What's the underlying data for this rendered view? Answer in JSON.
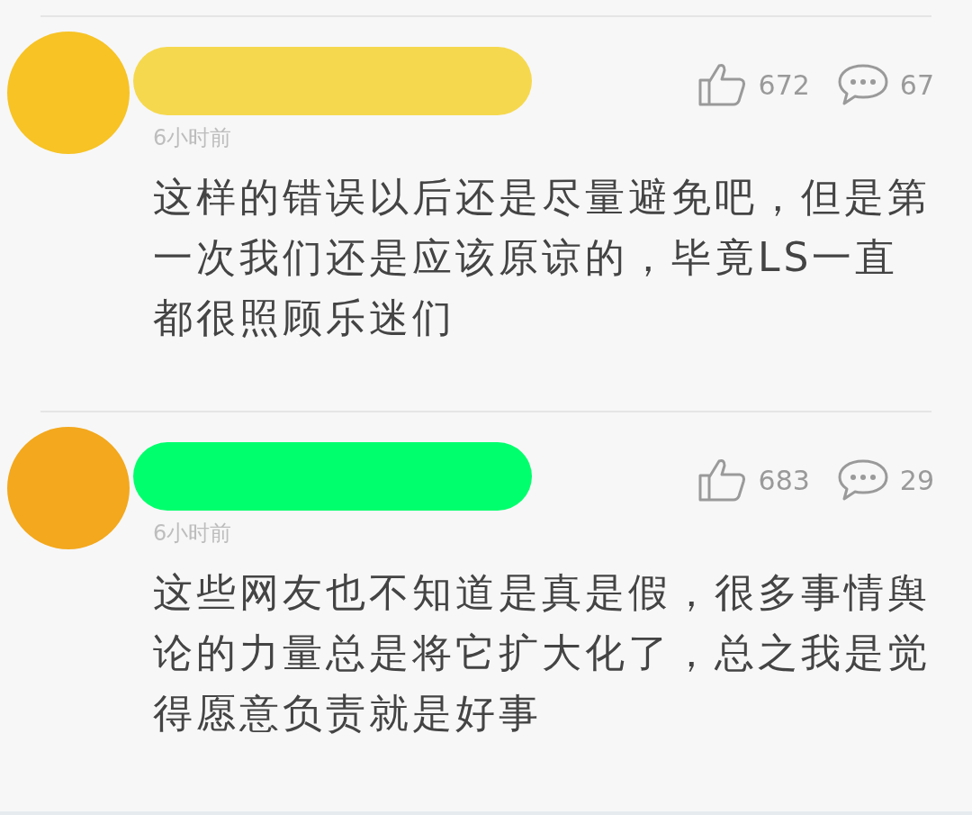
{
  "comments": [
    {
      "avatar": {
        "color": "#f7c325"
      },
      "name_mark": {
        "color": "#f5d84e"
      },
      "likes": "672",
      "replies": "67",
      "time": "6小时前",
      "text": "这样的错误以后还是尽量避免吧，但是第一次我们还是应该原谅的，毕竟LS一直都很照顾乐迷们"
    },
    {
      "avatar": {
        "color": "#f3a81d"
      },
      "name_mark": {
        "color": "#00ff6c"
      },
      "likes": "683",
      "replies": "29",
      "time": "6小时前",
      "text": "这些网友也不知道是真是假，很多事情舆论的力量总是将它扩大化了，总之我是觉得愿意负责就是好事"
    }
  ]
}
